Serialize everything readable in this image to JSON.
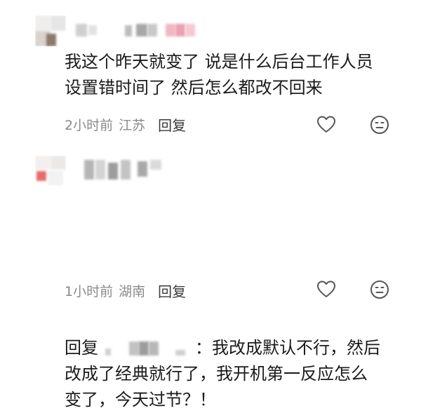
{
  "comments": [
    {
      "text": "我这个昨天就变了 说是什么后台工作人员\n设置错时间了 然后怎么都改不回来",
      "time": "2小时前",
      "location": "江苏",
      "reply_label": "回复",
      "icons": [
        "heart-outline-icon",
        "emoji-icon"
      ]
    },
    {
      "reply_prefix": "回复",
      "separator": "：",
      "text_line1": "我改成默认不行，然后",
      "text_line2": "改成了经典就行了，我开机第一反应怎么",
      "text_line3": "变了，今天过节？！",
      "time": "1小时前",
      "location": "湖南",
      "reply_label": "回复",
      "icons": [
        "heart-outline-icon",
        "emoji-icon"
      ]
    }
  ],
  "colors": {
    "text": "#1a1a1a",
    "meta": "#8a8a8a",
    "icon": "#555555"
  }
}
